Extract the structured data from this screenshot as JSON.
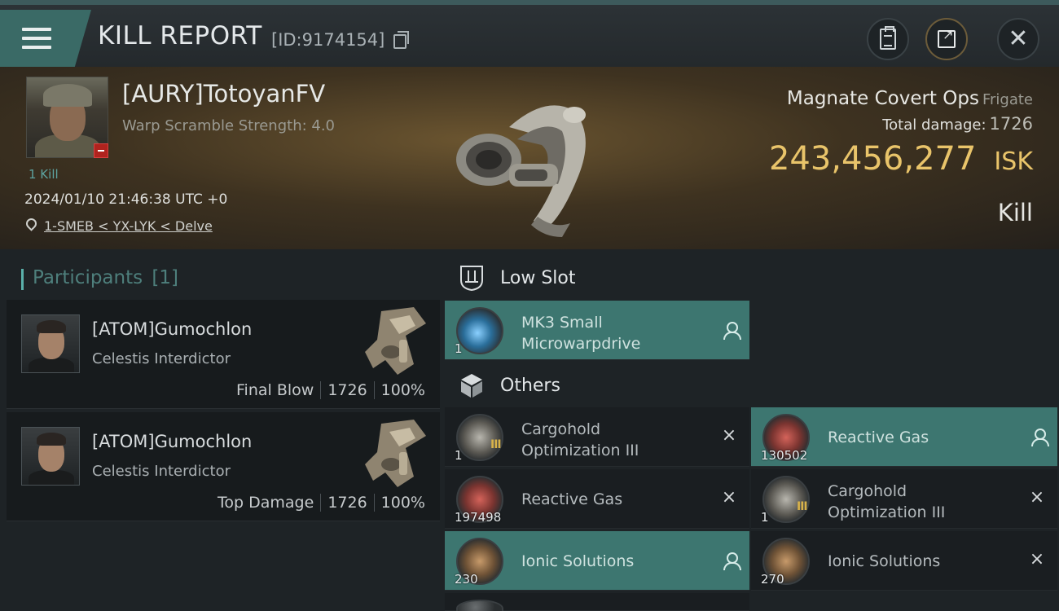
{
  "header": {
    "title": "KILL REPORT",
    "report_id": "[ID:9174154]"
  },
  "victim": {
    "name": "[AURY]TotoyanFV",
    "warp_scramble": "Warp Scramble Strength: 4.0",
    "kill_count": "1 Kill",
    "timestamp": "2024/01/10 21:46:38 UTC +0",
    "location": "1-SMEB < YX-LYK < Delve",
    "ship_name": "Magnate Covert Ops",
    "ship_class": "Frigate",
    "total_damage_label": "Total damage:",
    "total_damage": "1726",
    "isk_value": "243,456,277",
    "isk_unit": "ISK",
    "result": "Kill"
  },
  "participants": {
    "label": "Participants",
    "count": "[1]",
    "list": [
      {
        "name": "[ATOM]Gumochlon",
        "ship": "Celestis Interdictor",
        "role": "Final Blow",
        "damage": "1726",
        "percent": "100%"
      },
      {
        "name": "[ATOM]Gumochlon",
        "ship": "Celestis Interdictor",
        "role": "Top Damage",
        "damage": "1726",
        "percent": "100%"
      }
    ]
  },
  "sections": {
    "low_slot": "Low Slot",
    "others": "Others"
  },
  "items": {
    "low": [
      {
        "name": "MK3 Small Microwarpdrive",
        "qty": "1",
        "state": "fitted",
        "highlight": true
      }
    ],
    "others": [
      {
        "name": "Cargohold Optimization III",
        "qty": "1",
        "state": "destroyed",
        "highlight": false
      },
      {
        "name": "Reactive Gas",
        "qty": "130502",
        "state": "dropped",
        "highlight": true
      },
      {
        "name": "Reactive Gas",
        "qty": "197498",
        "state": "destroyed",
        "highlight": false
      },
      {
        "name": "Cargohold Optimization III",
        "qty": "1",
        "state": "destroyed",
        "highlight": false
      },
      {
        "name": "Ionic Solutions",
        "qty": "230",
        "state": "dropped",
        "highlight": true
      },
      {
        "name": "Ionic Solutions",
        "qty": "270",
        "state": "destroyed",
        "highlight": false
      }
    ]
  },
  "colors": {
    "accent": "#3d7670",
    "isk": "#e9c46a",
    "security_negative": "#b0231e"
  },
  "icons": {
    "destroyed": "×",
    "tech3": "III"
  }
}
